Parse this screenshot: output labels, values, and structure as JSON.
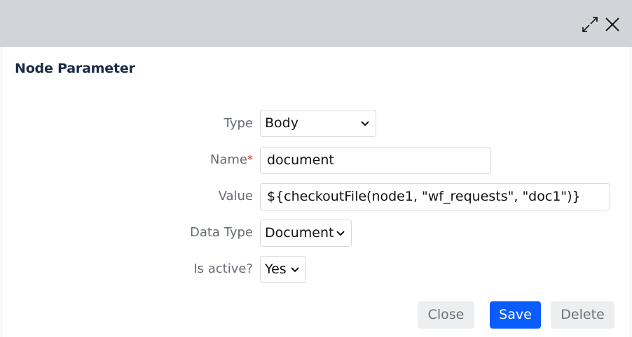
{
  "dialog": {
    "title": "Node Parameter",
    "titlebar": {
      "expand_icon": "expand-icon",
      "close_icon": "close-icon"
    }
  },
  "form": {
    "type": {
      "label": "Type",
      "value": "Body"
    },
    "name": {
      "label": "Name",
      "required_mark": "*",
      "value": "document"
    },
    "value": {
      "label": "Value",
      "value": "${checkoutFile(node1, \"wf_requests\", \"doc1\")}"
    },
    "data_type": {
      "label": "Data Type",
      "value": "Document"
    },
    "is_active": {
      "label": "Is active?",
      "value": "Yes"
    }
  },
  "buttons": {
    "close": "Close",
    "save": "Save",
    "delete": "Delete"
  },
  "colors": {
    "titlebar": "#d1d5d9",
    "primary": "#0a5cff",
    "required": "#c0392b",
    "title_text": "#1b2a44"
  }
}
